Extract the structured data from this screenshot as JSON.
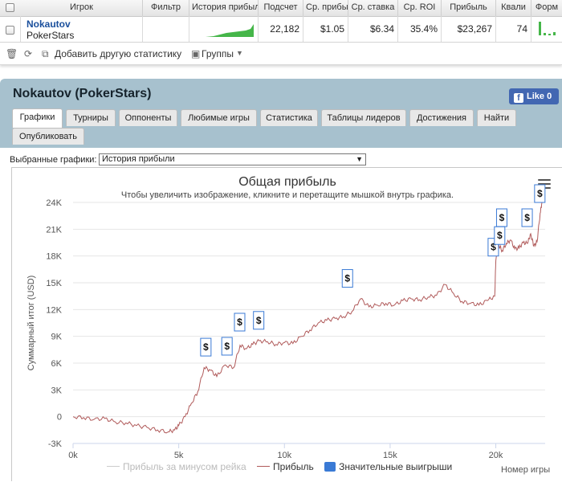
{
  "table": {
    "headers": [
      "Игрок",
      "Фильтр",
      "История прибыл",
      "Подсчет",
      "Ср. прибы",
      "Ср. ставка",
      "Ср. ROI",
      "Прибыль",
      "Квали",
      "Форм"
    ],
    "row": {
      "player": "Nokautov",
      "site": "PokerStars",
      "hands": "22,182",
      "avg_profit": "$1.05",
      "avg_stake": "$6.34",
      "avg_roi": "35.4%",
      "profit": "$23,267",
      "qual": "74"
    }
  },
  "toolbar": {
    "add_stats": "Добавить другую статистику",
    "groups": "Группы"
  },
  "panel": {
    "title": "Nokautov (PokerStars)",
    "like": "Like 0",
    "tabs": [
      "Графики",
      "Турниры",
      "Оппоненты",
      "Любимые игры",
      "Статистика",
      "Таблицы лидеров",
      "Достижения",
      "Найти",
      "Опубликовать"
    ]
  },
  "chart_select": {
    "label": "Выбранные графики:",
    "value": "История прибыли"
  },
  "chart_data": {
    "type": "line",
    "title": "Общая прибыль",
    "subtitle": "Чтобы увеличить изображение, кликните и перетащите мышкой внутрь графика.",
    "xlabel": "Номер игры",
    "ylabel": "Суммарный итог (USD)",
    "xlim": [
      0,
      22182
    ],
    "ylim": [
      -3000,
      24000
    ],
    "x_ticks": [
      "0k",
      "5k",
      "10k",
      "15k",
      "20k"
    ],
    "y_ticks": [
      "-3K",
      "0",
      "3K",
      "6K",
      "9K",
      "12K",
      "15K",
      "18K",
      "21K",
      "24K"
    ],
    "legend": [
      "Прибыль за минусом рейка",
      "Прибыль",
      "Значительные выигрыши"
    ],
    "legend_placement": "bottom",
    "colors": {
      "profit": "#b05a5a",
      "net_rake": "#cccccc",
      "big_wins": "#3a7ad5"
    },
    "series": [
      {
        "name": "Прибыль",
        "x": [
          0,
          500,
          1000,
          1500,
          2000,
          2500,
          3000,
          3500,
          4000,
          4500,
          4800,
          5000,
          5300,
          5600,
          5900,
          6200,
          6500,
          6800,
          7200,
          7600,
          7900,
          8200,
          8500,
          8800,
          9200,
          9600,
          10000,
          10400,
          10800,
          11200,
          11600,
          12000,
          12400,
          12800,
          13200,
          13600,
          14000,
          14400,
          14800,
          15200,
          15600,
          16000,
          16400,
          16800,
          17200,
          17600,
          18000,
          18400,
          18800,
          19200,
          19600,
          19950,
          20000,
          20150,
          20300,
          20500,
          20700,
          20900,
          21100,
          21300,
          21500,
          21650,
          21800,
          21950,
          22100,
          22182
        ],
        "y": [
          0,
          -100,
          -300,
          -200,
          -600,
          -700,
          -1000,
          -1200,
          -1500,
          -1700,
          -1500,
          -1000,
          0,
          1500,
          2800,
          5500,
          5200,
          4500,
          5800,
          5500,
          8000,
          7600,
          8100,
          8500,
          8400,
          8100,
          8300,
          8200,
          9000,
          9700,
          10500,
          10800,
          11000,
          11200,
          11800,
          13200,
          12300,
          12500,
          12700,
          12500,
          13000,
          13200,
          13100,
          13400,
          13600,
          14800,
          13800,
          12900,
          12700,
          12500,
          13000,
          13500,
          17500,
          19200,
          18600,
          19400,
          19800,
          18800,
          18900,
          19500,
          19400,
          20500,
          19100,
          19600,
          22800,
          24000
        ]
      }
    ],
    "big_wins": [
      {
        "x": 6300,
        "y": 6800,
        "label": "$"
      },
      {
        "x": 7300,
        "y": 6900,
        "label": "$"
      },
      {
        "x": 7900,
        "y": 9600,
        "label": "$"
      },
      {
        "x": 8800,
        "y": 9800,
        "label": "$"
      },
      {
        "x": 13000,
        "y": 14500,
        "label": "$"
      },
      {
        "x": 19900,
        "y": 18000,
        "label": "$"
      },
      {
        "x": 20200,
        "y": 19300,
        "label": "$"
      },
      {
        "x": 20300,
        "y": 21300,
        "label": "$"
      },
      {
        "x": 21500,
        "y": 21300,
        "label": "$"
      },
      {
        "x": 22100,
        "y": 24000,
        "label": "$"
      }
    ]
  }
}
